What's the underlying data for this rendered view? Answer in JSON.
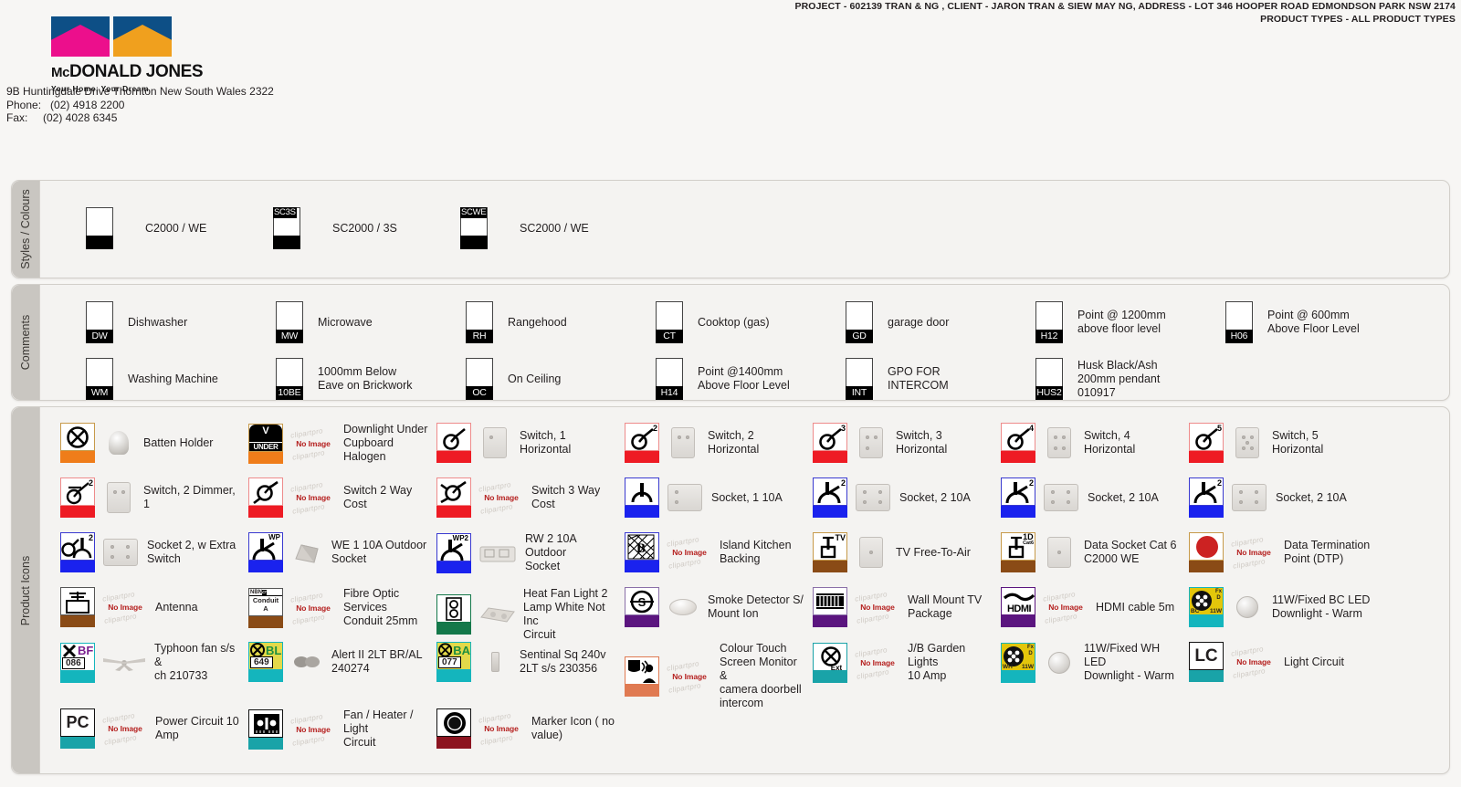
{
  "header": {
    "project_line": "PROJECT - 602139 TRAN & NG  ,  CLIENT - JARON TRAN & SIEW MAY NG,  ADDRESS - LOT 346 HOOPER ROAD  EDMONDSON PARK NSW 2174",
    "product_types_line": "PRODUCT TYPES - ALL PRODUCT TYPES"
  },
  "company": {
    "name_mc": "Mc",
    "name_rest": "DONALD JONES",
    "tagline": "Your Home, Your Dream",
    "address": "9B Huntingdale Drive Thornton New South Wales 2322",
    "phone": "Phone:   (02) 4918 2200",
    "fax": "Fax:     (02) 4028 6345"
  },
  "sections": {
    "styles": {
      "title": "Styles / Colours",
      "items": [
        {
          "code": "",
          "top": "",
          "label": "C2000 / WE"
        },
        {
          "code": "",
          "top": "SC3S",
          "label": "SC2000 / 3S"
        },
        {
          "code": "",
          "top": "SCWE",
          "label": "SC2000 / WE"
        }
      ]
    },
    "comments": {
      "title": "Comments",
      "items": [
        {
          "code": "DW",
          "label": "Dishwasher"
        },
        {
          "code": "MW",
          "label": "Microwave"
        },
        {
          "code": "RH",
          "label": "Rangehood"
        },
        {
          "code": "CT",
          "label": "Cooktop (gas)"
        },
        {
          "code": "GD",
          "label": "garage door"
        },
        {
          "code": "H12",
          "label": "Point @ 1200mm\nabove floor level"
        },
        {
          "code": "H06",
          "label": "Point @ 600mm\nAbove Floor Level"
        },
        {
          "code": "WM",
          "label": "Washing Machine"
        },
        {
          "code": "10BE",
          "label": "1000mm Below\nEave on Brickwork"
        },
        {
          "code": "OC",
          "label": "On Ceiling"
        },
        {
          "code": "H14",
          "label": "Point @1400mm\nAbove Floor Level"
        },
        {
          "code": "INT",
          "label": "GPO FOR\nINTERCOM"
        },
        {
          "code": "HUS2",
          "label": "Husk Black/Ash\n200mm pendant\n010917"
        }
      ]
    },
    "product_icons": {
      "title": "Product Icons",
      "no_image_text": "No Image",
      "watermark_text": "clipartpro",
      "items": [
        {
          "label": "Batten Holder",
          "icon": "batten-holder",
          "badge": "",
          "foot": "#ef7d1a",
          "frame": "#c79a4a",
          "photo": "knob"
        },
        {
          "label": "Downlight Under\nCupboard Halogen",
          "icon": "v-under",
          "badge": "",
          "foot": "#ef7d1a",
          "frame": "#c79a4a",
          "photo": "noimage"
        },
        {
          "label": "Switch, 1 Horizontal",
          "icon": "switch",
          "badge": "",
          "foot": "#ee1b24",
          "frame": "#ee8b8b",
          "photo": "plate1"
        },
        {
          "label": "Switch, 2 Horizontal",
          "icon": "switch",
          "badge": "2",
          "foot": "#ee1b24",
          "frame": "#ee8b8b",
          "photo": "plate2"
        },
        {
          "label": "Switch, 3 Horizontal",
          "icon": "switch",
          "badge": "3",
          "foot": "#ee1b24",
          "frame": "#ee8b8b",
          "photo": "plate3"
        },
        {
          "label": "Switch, 4 Horizontal",
          "icon": "switch",
          "badge": "4",
          "foot": "#ee1b24",
          "frame": "#ee8b8b",
          "photo": "plate4"
        },
        {
          "label": "Switch, 5 Horizontal",
          "icon": "switch",
          "badge": "5",
          "foot": "#ee1b24",
          "frame": "#ee8b8b",
          "photo": "plate5"
        },
        {
          "label": "Switch, 2 Dimmer, 1",
          "icon": "switch-dimmer",
          "badge": "2",
          "foot": "#ee1b24",
          "frame": "#ee8b8b",
          "photo": "plate2"
        },
        {
          "label": "Switch 2 Way Cost",
          "icon": "switch-2way",
          "badge": "",
          "foot": "#ee1b24",
          "frame": "#ee8b8b",
          "photo": "noimage"
        },
        {
          "label": "Switch 3 Way Cost",
          "icon": "switch-3way",
          "badge": "",
          "foot": "#ee1b24",
          "frame": "#ee8b8b",
          "photo": "noimage"
        },
        {
          "label": "Socket, 1 10A",
          "icon": "socket1",
          "badge": "",
          "foot": "#1a22ee",
          "frame": "#3a3ad0",
          "photo": "plate-socket1"
        },
        {
          "label": "Socket, 2 10A",
          "icon": "socket2",
          "badge": "2",
          "foot": "#1a22ee",
          "frame": "#3a3ad0",
          "photo": "plate-socket2"
        },
        {
          "label": "Socket, 2 10A",
          "icon": "socket2",
          "badge": "2",
          "foot": "#1a22ee",
          "frame": "#3a3ad0",
          "photo": "plate-socket2"
        },
        {
          "label": "Socket, 2 10A",
          "icon": "socket2",
          "badge": "2",
          "foot": "#1a22ee",
          "frame": "#3a3ad0",
          "photo": "plate-socket2"
        },
        {
          "label": "Socket 2, w Extra\nSwitch",
          "icon": "socket-extra",
          "badge": "2",
          "foot": "#1a22ee",
          "frame": "#3a3ad0",
          "photo": "plate-socket2"
        },
        {
          "label": "WE 1 10A Outdoor\nSocket",
          "icon": "socket-wp",
          "badge": "WP",
          "foot": "#1a22ee",
          "frame": "#3a3ad0",
          "photo": "outdoor1"
        },
        {
          "label": "RW 2 10A Outdoor\nSocket",
          "icon": "socket-wp2",
          "badge": "WP2",
          "foot": "#1a22ee",
          "frame": "#3a3ad0",
          "photo": "outdoor2"
        },
        {
          "label": "Island Kitchen\nBacking",
          "icon": "island-backing",
          "badge": "",
          "foot": "#1a22ee",
          "frame": "#3a3ad0",
          "photo": "noimage"
        },
        {
          "label": "TV Free-To-Air",
          "icon": "tv-point",
          "badge": "TV",
          "foot": "#8a4b16",
          "frame": "#c79a4a",
          "photo": "plate-small"
        },
        {
          "label": "Data Socket Cat 6\nC2000 WE",
          "icon": "data-point",
          "badge": "1D",
          "foot": "#8a4b16",
          "frame": "#c79a4a",
          "photo": "plate-small"
        },
        {
          "label": "Data Termination\nPoint (DTP)",
          "icon": "dtp-circle",
          "badge": "",
          "foot": "#8a4b16",
          "frame": "#c79a4a",
          "photo": "noimage"
        },
        {
          "label": "Antenna",
          "icon": "antenna",
          "badge": "",
          "foot": "#8a4b16",
          "frame": "#555",
          "photo": "noimage"
        },
        {
          "label": "Fibre Optic Services\nConduit 25mm",
          "icon": "nbn-conduit",
          "badge": "",
          "foot": "#8a4b16",
          "frame": "#555",
          "photo": "noimage"
        },
        {
          "label": "Heat Fan Light 2\nLamp White Not Inc\nCircuit",
          "icon": "heat-fan-light",
          "badge": "",
          "foot": "#14784a",
          "frame": "#14784a",
          "photo": "heatlamp"
        },
        {
          "label": "Smoke Detector S/\nMount Ion",
          "icon": "smoke-detector",
          "badge": "",
          "foot": "#5b157f",
          "frame": "#8a6fa8",
          "photo": "smoke"
        },
        {
          "label": "Wall Mount TV\nPackage",
          "icon": "wall-mount-tv",
          "badge": "",
          "foot": "#5b157f",
          "frame": "#8a6fa8",
          "photo": "noimage"
        },
        {
          "label": "HDMI cable 5m",
          "icon": "hdmi",
          "badge": "",
          "foot": "#5b157f",
          "frame": "#5b157f",
          "photo": "noimage"
        },
        {
          "label": "11W/Fixed BC LED\nDownlight - Warm",
          "icon": "led-bc",
          "badge": "",
          "foot": "#14b5bd",
          "frame": "#14b5bd",
          "photo": "downlight"
        },
        {
          "label": "Typhoon fan s/s &\nch 210733",
          "icon": "bf-086",
          "badge": "",
          "foot": "#14b5bd",
          "frame": "#14b5bd",
          "photo": "fan"
        },
        {
          "label": "Alert II 2LT BR/AL\n240274",
          "icon": "bl-649",
          "badge": "",
          "foot": "#14b5bd",
          "frame": "#14b5bd",
          "photo": "binoc"
        },
        {
          "label": "Sentinal Sq 240v\n2LT s/s 230356",
          "icon": "ba-077",
          "badge": "",
          "foot": "#14b5bd",
          "frame": "#14b5bd",
          "photo": "sq-grey"
        },
        {
          "label": "Colour Touch\nScreen Monitor &\ncamera doorbell\nintercom",
          "icon": "doorbell-intercom",
          "badge": "",
          "foot": "#e07a52",
          "frame": "#e07a52",
          "photo": "noimage"
        },
        {
          "label": "J/B Garden Lights\n10 Amp",
          "icon": "jb-ext",
          "badge": "",
          "foot": "#19a3a8",
          "frame": "#19a3a8",
          "photo": "noimage"
        },
        {
          "label": "11W/Fixed WH LED\nDownlight - Warm",
          "icon": "led-wh",
          "badge": "",
          "foot": "#14b5bd",
          "frame": "#14b5bd",
          "photo": "downlight"
        },
        {
          "label": "Light Circuit",
          "icon": "lc",
          "badge": "",
          "foot": "#19a3a8",
          "frame": "#111",
          "photo": "noimage"
        },
        {
          "label": "Power Circuit 10\nAmp",
          "icon": "pc",
          "badge": "",
          "foot": "#19a3a8",
          "frame": "#111",
          "photo": "noimage"
        },
        {
          "label": "Fan / Heater / Light\nCircuit",
          "icon": "fan-heater-light",
          "badge": "",
          "foot": "#19a3a8",
          "frame": "#111",
          "photo": "noimage"
        },
        {
          "label": "Marker Icon ( no\nvalue)",
          "icon": "marker",
          "badge": "",
          "foot": "#8c1420",
          "frame": "#111",
          "photo": "noimage"
        }
      ]
    }
  },
  "colors": {
    "orange": "#ef7d1a",
    "red": "#ee1b24",
    "blue": "#1a22ee",
    "brown": "#8a4b16",
    "green": "#14784a",
    "purple": "#5b157f",
    "teal": "#14b5bd",
    "salmon": "#e07a52",
    "darkred": "#8c1420"
  }
}
